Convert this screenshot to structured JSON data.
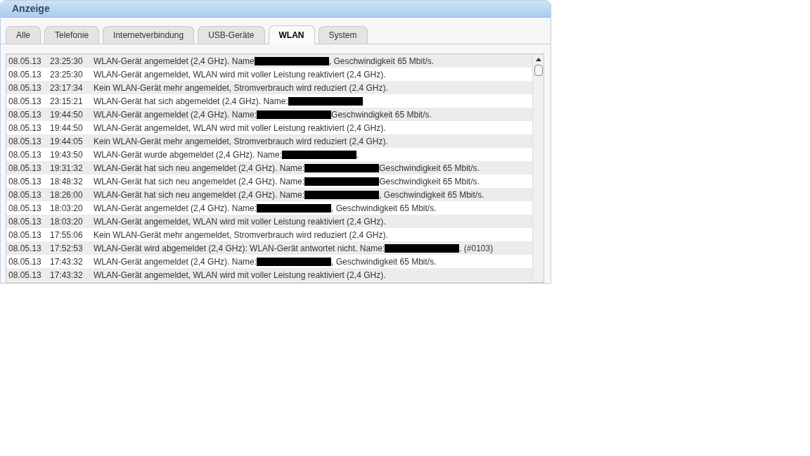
{
  "panel": {
    "title": "Anzeige"
  },
  "tabs": [
    {
      "label": "Alle",
      "selected": false
    },
    {
      "label": "Telefonie",
      "selected": false
    },
    {
      "label": "Internetverbindung",
      "selected": false
    },
    {
      "label": "USB-Geräte",
      "selected": false
    },
    {
      "label": "WLAN",
      "selected": true
    },
    {
      "label": "System",
      "selected": false
    }
  ],
  "log": [
    {
      "date": "08.05.13",
      "time": "23:25:30",
      "before": "WLAN-Gerät angemeldet (2,4 GHz). Name",
      "redacted": true,
      "after": ", Geschwindigkeit 65 Mbit/s."
    },
    {
      "date": "08.05.13",
      "time": "23:25:30",
      "before": "WLAN-Gerät angemeldet, WLAN wird mit voller Leistung reaktiviert (2,4 GHz).",
      "redacted": false
    },
    {
      "date": "08.05.13",
      "time": "23:17:34",
      "before": "Kein WLAN-Gerät mehr angemeldet, Stromverbrauch wird reduziert (2,4 GHz).",
      "redacted": false
    },
    {
      "date": "08.05.13",
      "time": "23:15:21",
      "before": "WLAN-Gerät hat sich abgemeldet (2,4 GHz). Name:",
      "redacted": true
    },
    {
      "date": "08.05.13",
      "time": "19:44:50",
      "before": "WLAN-Gerät angemeldet (2,4 GHz). Name:",
      "redacted": true,
      "after": "Geschwindigkeit 65 Mbit/s."
    },
    {
      "date": "08.05.13",
      "time": "19:44:50",
      "before": "WLAN-Gerät angemeldet, WLAN wird mit voller Leistung reaktiviert (2,4 GHz).",
      "redacted": false
    },
    {
      "date": "08.05.13",
      "time": "19:44:05",
      "before": "Kein WLAN-Gerät mehr angemeldet, Stromverbrauch wird reduziert (2,4 GHz).",
      "redacted": false
    },
    {
      "date": "08.05.13",
      "time": "19:43:50",
      "before": "WLAN-Gerät wurde abgemeldet (2,4 GHz). Name:",
      "redacted": true,
      "after": "."
    },
    {
      "date": "08.05.13",
      "time": "19:31:32",
      "before": "WLAN-Gerät hat sich neu angemeldet (2,4 GHz). Name:",
      "redacted": true,
      "after": "Geschwindigkeit 65 Mbit/s."
    },
    {
      "date": "08.05.13",
      "time": "18:48:32",
      "before": "WLAN-Gerät hat sich neu angemeldet (2,4 GHz). Name:",
      "redacted": true,
      "after": "Geschwindigkeit 65 Mbit/s."
    },
    {
      "date": "08.05.13",
      "time": "18:26:00",
      "before": "WLAN-Gerät hat sich neu angemeldet (2,4 GHz). Name:",
      "redacted": true,
      "after": ", Geschwindigkeit 65 Mbit/s."
    },
    {
      "date": "08.05.13",
      "time": "18:03:20",
      "before": "WLAN-Gerät angemeldet (2,4 GHz). Name:",
      "redacted": true,
      "after": ", Geschwindigkeit 65 Mbit/s."
    },
    {
      "date": "08.05.13",
      "time": "18:03:20",
      "before": "WLAN-Gerät angemeldet, WLAN wird mit voller Leistung reaktiviert (2,4 GHz).",
      "redacted": false
    },
    {
      "date": "08.05.13",
      "time": "17:55:06",
      "before": "Kein WLAN-Gerät mehr angemeldet, Stromverbrauch wird reduziert (2,4 GHz).",
      "redacted": false
    },
    {
      "date": "08.05.13",
      "time": "17:52:53",
      "before": "WLAN-Gerät wird abgemeldet (2,4 GHz): WLAN-Gerät antwortet nicht. Name:",
      "redacted": true,
      "after": ". (#0103)"
    },
    {
      "date": "08.05.13",
      "time": "17:43:32",
      "before": "WLAN-Gerät angemeldet (2,4 GHz). Name:",
      "redacted": true,
      "after": ", Geschwindigkeit 65 Mbit/s."
    },
    {
      "date": "08.05.13",
      "time": "17:43:32",
      "before": "WLAN-Gerät angemeldet, WLAN wird mit voller Leistung reaktiviert (2,4 GHz).",
      "redacted": false
    }
  ]
}
